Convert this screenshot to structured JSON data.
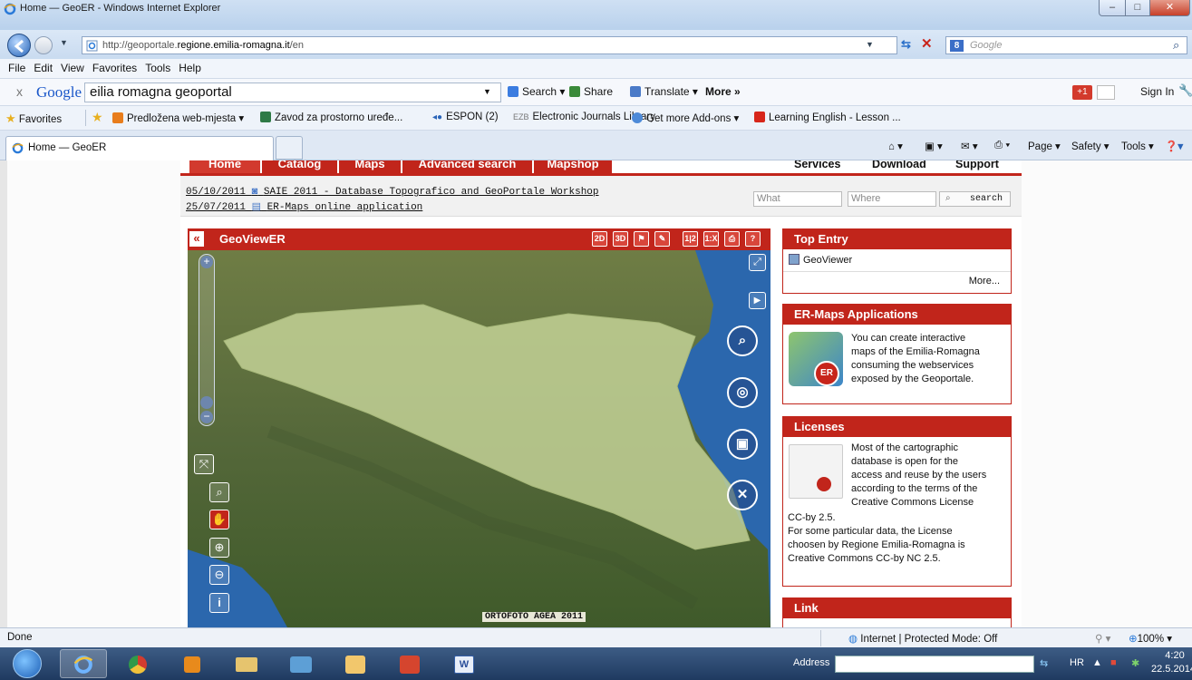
{
  "window": {
    "title": "Home — GeoER - Windows Internet Explorer",
    "min": "–",
    "max": "□",
    "close": "✕"
  },
  "address": {
    "url_prefix": "http://geoportale.",
    "url_domain": "regione.emilia-romagna.it",
    "url_suffix": "/en",
    "search_placeholder": "Google"
  },
  "menu": [
    "File",
    "Edit",
    "View",
    "Favorites",
    "Tools",
    "Help"
  ],
  "google_toolbar": {
    "close": "x",
    "logo": "Google",
    "query": "eilia romagna geoportal",
    "search": "Search",
    "share": "Share",
    "translate": "Translate",
    "more": "More »",
    "plus_one": "+1",
    "sign_in": "Sign In"
  },
  "favorites_bar": {
    "favorites": "Favorites",
    "items": [
      "Predložena web-mjesta",
      "Zavod za prostorno uređe...",
      "ESPON (2)",
      "Electronic Journals Library",
      "Get more Add-ons",
      "Learning English - Lesson ..."
    ]
  },
  "tab": {
    "label": "Home — GeoER",
    "commands": [
      "Page",
      "Safety",
      "Tools"
    ]
  },
  "site": {
    "nav_tabs": [
      "Home",
      "Catalog",
      "Maps",
      "Advanced search",
      "Mapshop"
    ],
    "nav_links": [
      "Services",
      "Download",
      "Support"
    ],
    "news": [
      {
        "date": "05/10/2011",
        "text": "SAIE 2011 - Database Topografico and GeoPortale Workshop"
      },
      {
        "date": "25/07/2011",
        "text": "ER-Maps online application"
      }
    ],
    "search": {
      "what_placeholder": "What",
      "where_placeholder": "Where",
      "button": "search"
    },
    "viewer": {
      "title": "GeoViewER",
      "collapse": "«",
      "toolbar": [
        "2D",
        "3D",
        "",
        "",
        "1|2",
        "1:X",
        "",
        "?"
      ],
      "ortho_label": "ORTOFOTO AGEA 2011"
    },
    "panels": {
      "top_entry": {
        "title": "Top Entry",
        "item": "GeoViewer",
        "more": "More..."
      },
      "ermaps": {
        "title": "ER-Maps Applications",
        "text": [
          "You can create interactive",
          "maps of the Emilia-Romagna",
          "consuming the webservices",
          "exposed by the Geoportale."
        ]
      },
      "licenses": {
        "title": "Licenses",
        "text_right": [
          "Most of the cartographic",
          "database is open for the",
          "access and reuse by the users",
          "according to the terms of the",
          "Creative Commons License"
        ],
        "text_full": [
          "CC-by 2.5.",
          "For some particular data, the License",
          "choosen by Regione Emilia-Romagna is",
          "Creative Commons CC-by NC 2.5."
        ]
      },
      "link": {
        "title": "Link"
      }
    }
  },
  "status": {
    "left": "Done",
    "zone": "Internet | Protected Mode: Off",
    "zoom": "100%"
  },
  "taskbar": {
    "address_label": "Address",
    "lang": "HR",
    "time": "4:20",
    "date": "22.5.2014."
  }
}
